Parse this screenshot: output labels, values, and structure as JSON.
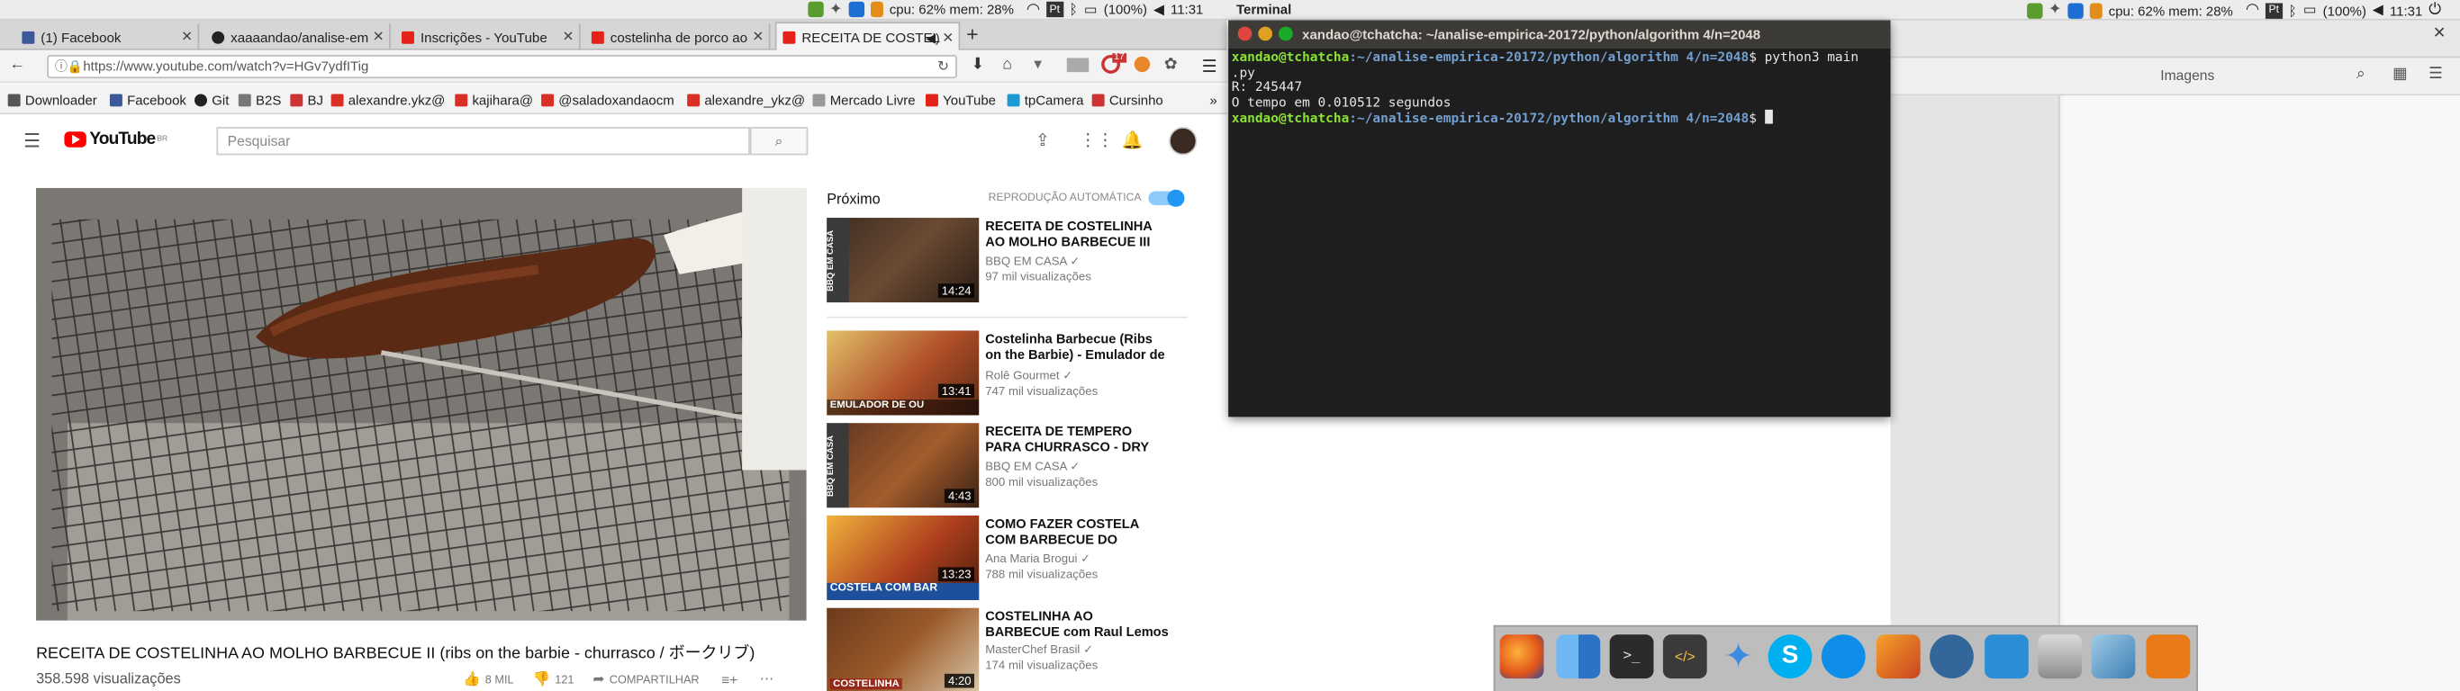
{
  "top_panel": {
    "cpu": "cpu: 62% mem: 28%",
    "battery": "(100%)",
    "time": "11:31",
    "app_name": "Terminal",
    "pt_badge": "Pt"
  },
  "browser": {
    "tabs": [
      {
        "label": "(1) Facebook"
      },
      {
        "label": "xaaaandao/analise-em"
      },
      {
        "label": "Inscrições - YouTube"
      },
      {
        "label": "costelinha de porco ao"
      },
      {
        "label": "RECEITA DE COSTEL"
      }
    ],
    "new_tab": "+",
    "url": "https://www.youtube.com/watch?v=HGv7ydfITig",
    "badge_count": "17",
    "bookmarks": [
      {
        "label": "Downloader"
      },
      {
        "label": "Facebook"
      },
      {
        "label": "Git"
      },
      {
        "label": "B2S"
      },
      {
        "label": "BJ"
      },
      {
        "label": "alexandre.ykz@"
      },
      {
        "label": "kajihara@"
      },
      {
        "label": "@saladoxandaocm"
      },
      {
        "label": "alexandre_ykz@"
      },
      {
        "label": "Mercado Livre"
      },
      {
        "label": "YouTube"
      },
      {
        "label": "tpCamera"
      },
      {
        "label": "Cursinho"
      }
    ],
    "bookmark_overflow": "»"
  },
  "youtube": {
    "logo": "YouTube",
    "logo_sup": "BR",
    "search_placeholder": "Pesquisar",
    "video_title": "RECEITA DE COSTELINHA AO MOLHO BARBECUE II (ribs on the barbie - churrasco / ボークリブ)",
    "views": "358.598 visualizações",
    "likes": "8 MIL",
    "dislikes": "121",
    "share": "COMPARTILHAR",
    "next_label": "Próximo",
    "autoplay_label": "REPRODUÇÃO AUTOMÁTICA",
    "related": [
      {
        "title": "RECEITA DE COSTELINHA AO MOLHO BARBECUE III (ribs on",
        "channel": "BBQ EM CASA",
        "views": "97 mil visualizações",
        "duration": "14:24"
      },
      {
        "title": "Costelinha Barbecue (Ribs on the Barbie) - Emulador de",
        "channel": "Rolê Gourmet",
        "views": "747 mil visualizações",
        "duration": "13:41"
      },
      {
        "title": "RECEITA DE TEMPERO PARA CHURRASCO - DRY RUB",
        "channel": "BBQ EM CASA",
        "views": "800 mil visualizações",
        "duration": "4:43"
      },
      {
        "title": "COMO FAZER COSTELA COM BARBECUE DO APPLEBEE'S |",
        "channel": "Ana Maria Brogui",
        "views": "788 mil visualizações",
        "duration": "13:23"
      },
      {
        "title": "COSTELINHA AO BARBECUE com Raul Lemos | DICAS",
        "channel": "MasterChef Brasil",
        "views": "174 mil visualizações",
        "duration": "4:20"
      }
    ],
    "thumb_texts": [
      "BBQ EM CASA",
      "EMULADOR DE OU",
      "BBQ EM CASA",
      "COSTELA COM BAR",
      "COSTELINHA"
    ]
  },
  "terminal": {
    "title": "xandao@tchatcha: ~/analise-empirica-20172/python/algorithm 4/n=2048",
    "prompt_user": "xandao@tchatcha",
    "prompt_path": ":~/analise-empirica-20172/python/algorithm 4/n=2048",
    "command": "$ python3 main",
    "command_wrap": ".py",
    "output1": "R: 245447",
    "output2": "O tempo em 0.010512 segundos",
    "prompt2_end": "$ "
  },
  "file_manager": {
    "title": "Imagens",
    "ghost_item": "Imagens"
  },
  "colors": {
    "youtube_red": "#ff0000",
    "terminal_bg": "#1e1e1e",
    "prompt_green": "#8ae234",
    "prompt_blue": "#729fcf",
    "autoplay_blue": "#2196f3"
  }
}
